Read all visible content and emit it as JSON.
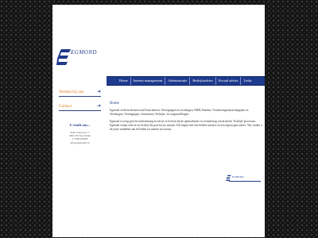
{
  "brand": {
    "name": "EGMOND"
  },
  "nav": {
    "items": [
      "Home",
      "Interim management",
      "Administratie",
      "Bedrijfsadvies",
      "Fiscaal advies",
      "Links"
    ]
  },
  "sidebar": {
    "buttons": [
      {
        "label": "Werken bij ons",
        "icon": "arrow-right-icon"
      },
      {
        "label": "Contact",
        "icon": "arrow-right-icon"
      }
    ],
    "find_us_title": "U vindt ons...",
    "address_lines": [
      "Pelle Claesweg 3-7",
      "9602 CB  Velp Oleum",
      "T. 0596-645000",
      "info@egmondbv.nl"
    ]
  },
  "main": {
    "title": "Home",
    "paragraphs": [
      "Egmond verleent diensten aan Particulieren, Verenigingen en stichtingen, MKB, Banken, Verzekeringsmaatschappijen en Stichtingen, Verenigingen, Gemeenten, Welzijns- en zorginstellingen.",
      "Egmond is terug gericht onderneming en advies te leveren bij de optimalisatie en verandering van kritische \"bedrijfs\"processen. Egmond schept orde in uw bedrijf die past bij uw situatie. Die begint met een heldere analyse en een afgewogen advies. Wij vinden u de juiste middelen aan de leiden tot intense successen."
    ]
  },
  "footer": {
    "brand": "EGMOND"
  },
  "colors": {
    "brand_blue": "#1f3a8c",
    "accent_orange": "#e37b1d",
    "nav_bg": "#1f3b8e"
  }
}
